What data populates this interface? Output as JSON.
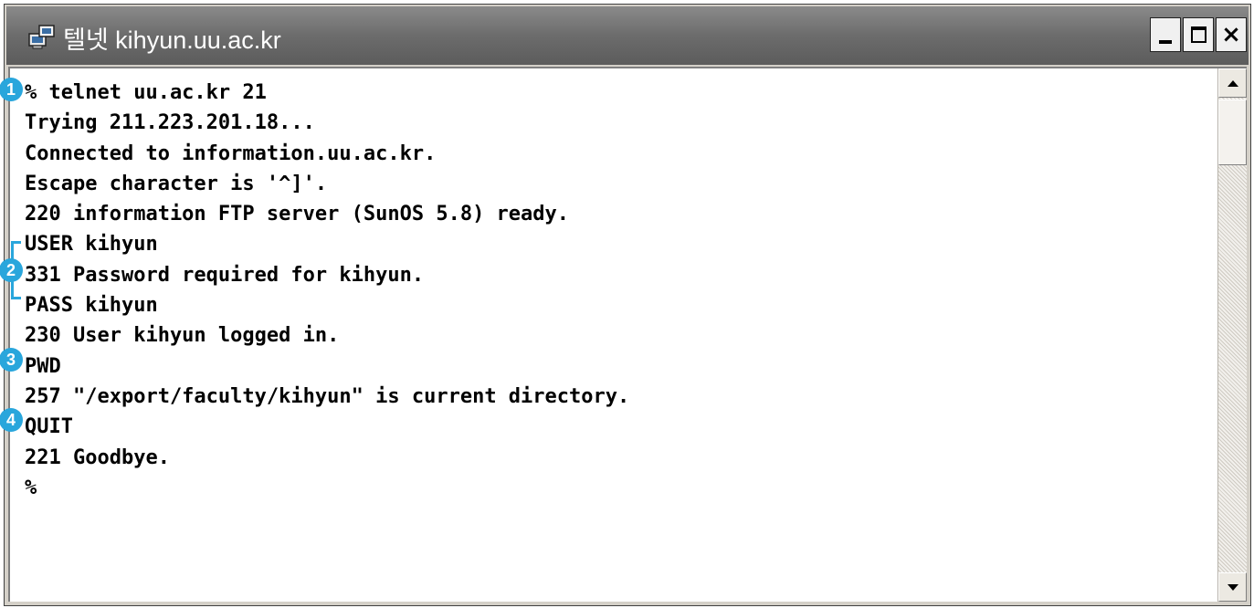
{
  "window": {
    "title": "텔넷 kihyun.uu.ac.kr",
    "title_icon": "telnet-terminal-icon",
    "controls": {
      "minimize_icon": "minimize-icon",
      "maximize_icon": "maximize-icon",
      "close_icon": "close-icon",
      "close_glyph": "×"
    }
  },
  "terminal": {
    "lines": [
      "% telnet uu.ac.kr 21",
      "Trying 211.223.201.18...",
      "Connected to information.uu.ac.kr.",
      "Escape character is '^]'.",
      "220 information FTP server (SunOS 5.8) ready.",
      "USER kihyun",
      "331 Password required for kihyun.",
      "PASS kihyun",
      "230 User kihyun logged in.",
      "PWD",
      "257 \"/export/faculty/kihyun\" is current directory.",
      "QUIT",
      "221 Goodbye.",
      "%"
    ]
  },
  "annotations": {
    "markers": [
      "1",
      "2",
      "3",
      "4"
    ],
    "color": "#29a6dc"
  },
  "scrollbar": {
    "up_icon": "scroll-up-arrow-icon",
    "down_icon": "scroll-down-arrow-icon"
  }
}
